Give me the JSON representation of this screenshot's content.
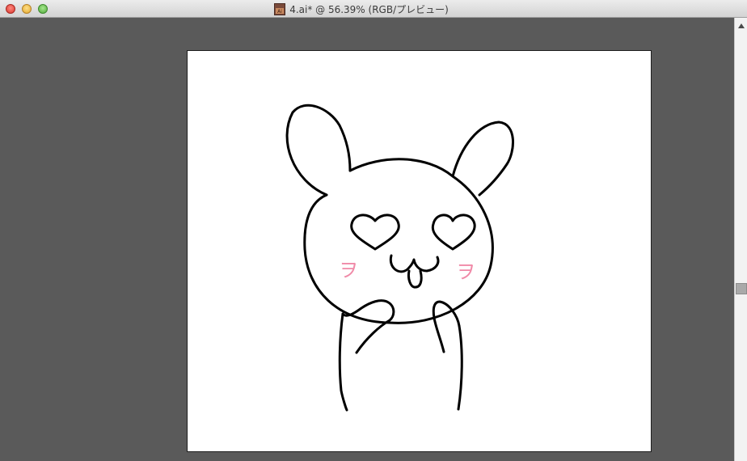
{
  "window": {
    "title": "4.ai* @ 56.39% (RGB/プレビュー)"
  },
  "icons": {
    "close": "close-icon",
    "minimize": "minimize-icon",
    "zoom": "zoom-icon",
    "document": "ai-document-icon",
    "scroll_up": "chevron-up-icon"
  },
  "artwork": {
    "blush_left": "ヲ",
    "blush_right": "ヲ",
    "blush_color": "#f08aa8",
    "stroke_color": "#000000"
  },
  "colors": {
    "canvas_background": "#5a5a5a",
    "artboard_background": "#ffffff"
  }
}
